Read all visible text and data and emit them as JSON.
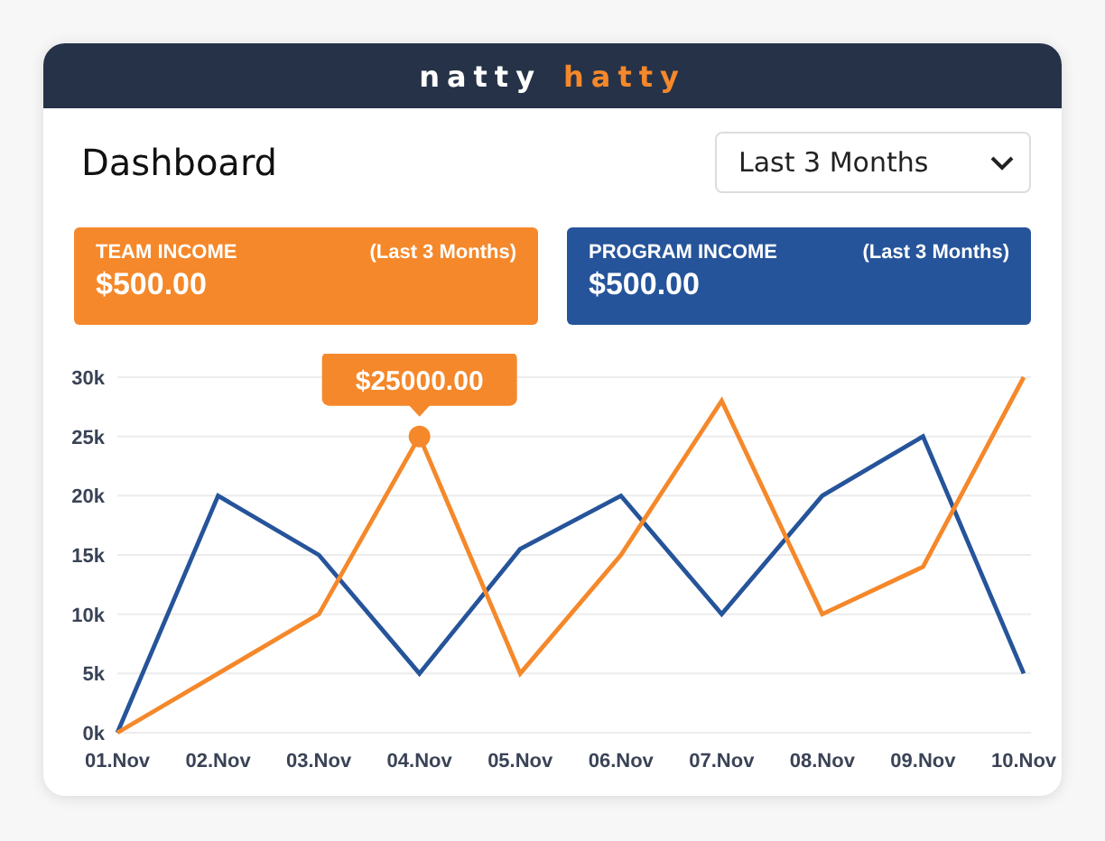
{
  "logo": [
    {
      "text": "natty",
      "color": "#ffffff"
    },
    {
      "text": "hatty",
      "color": "#f5882a"
    }
  ],
  "title": "Dashboard",
  "period_select": {
    "value": "Last 3 Months"
  },
  "income_cards": [
    {
      "label": "TEAM INCOME",
      "period": "(Last 3 Months)",
      "amount": "$500.00",
      "color": "#f5882a"
    },
    {
      "label": "PROGRAM INCOME",
      "period": "(Last 3 Months)",
      "amount": "$500.00",
      "color": "#26549a"
    }
  ],
  "chart": {
    "chart_data": {
      "type": "line",
      "categories": [
        "01.Nov",
        "02.Nov",
        "03.Nov",
        "04.Nov",
        "05.Nov",
        "06.Nov",
        "07.Nov",
        "08.Nov",
        "09.Nov",
        "10.Nov"
      ],
      "series": [
        {
          "color": "#26549a",
          "values": [
            0,
            20000,
            15000,
            5000,
            15500,
            20000,
            10000,
            20000,
            25000,
            5000
          ]
        },
        {
          "color": "#f5882a",
          "values": [
            0,
            5000,
            10000,
            25000,
            5000,
            15000,
            28000,
            10000,
            14000,
            30000
          ]
        }
      ],
      "ylim": [
        0,
        30000
      ],
      "yticks": [
        {
          "value": 0,
          "label": "0k"
        },
        {
          "value": 5000,
          "label": "5k"
        },
        {
          "value": 10000,
          "label": "10k"
        },
        {
          "value": 15000,
          "label": "15k"
        },
        {
          "value": 20000,
          "label": "20k"
        },
        {
          "value": 25000,
          "label": "25k"
        },
        {
          "value": 30000,
          "label": "30k"
        }
      ],
      "grid": true,
      "annotations": [
        {
          "x": "04.Nov",
          "y": 25000,
          "text": "$25000.00"
        }
      ]
    }
  }
}
